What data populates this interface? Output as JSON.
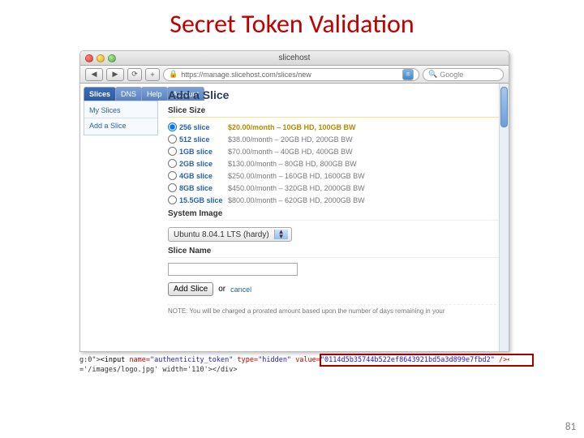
{
  "title": "Secret Token Validation",
  "page_number": "81",
  "browser": {
    "window_title": "slicehost",
    "url": "https://manage.slicehost.com/slices/new",
    "search_placeholder": "Google"
  },
  "sidebar": {
    "tabs": [
      "Slices",
      "DNS",
      "Help",
      "Account"
    ],
    "links": [
      "My Slices",
      "Add a Slice"
    ]
  },
  "form": {
    "heading": "Add a Slice",
    "size_label": "Slice Size",
    "options": [
      {
        "name": "256 slice",
        "desc": "$20.00/month – 10GB HD, 100GB BW",
        "selected": true
      },
      {
        "name": "512 slice",
        "desc": "$38.00/month – 20GB HD, 200GB BW"
      },
      {
        "name": "1GB slice",
        "desc": "$70.00/month – 40GB HD, 400GB BW"
      },
      {
        "name": "2GB slice",
        "desc": "$130.00/month – 80GB HD, 800GB BW"
      },
      {
        "name": "4GB slice",
        "desc": "$250.00/month – 160GB HD, 1600GB BW"
      },
      {
        "name": "8GB slice",
        "desc": "$450.00/month – 320GB HD, 2000GB BW"
      },
      {
        "name": "15.5GB slice",
        "desc": "$800.00/month – 620GB HD, 2000GB BW"
      }
    ],
    "system_image_label": "System Image",
    "system_image_value": "Ubuntu 8.04.1 LTS (hardy)",
    "name_label": "Slice Name",
    "submit": "Add Slice",
    "or": "or",
    "cancel": "cancel",
    "note": "NOTE: You will be charged a prorated amount based upon the number of days remaining in your"
  },
  "code": {
    "line1_pre": "g:0\">",
    "tag_open": "<input",
    "name_attr": "name=",
    "name_val": "\"authenticity_token\"",
    "type_attr": "type=",
    "type_val": "\"hidden\"",
    "value_attr": "value=",
    "value_val": "\"0114d5b35744b522ef8643921bd5a3d899e7fbd2\"",
    "line1_post": " /></d",
    "line2": "='/images/logo.jpg' width='110'></div>"
  }
}
